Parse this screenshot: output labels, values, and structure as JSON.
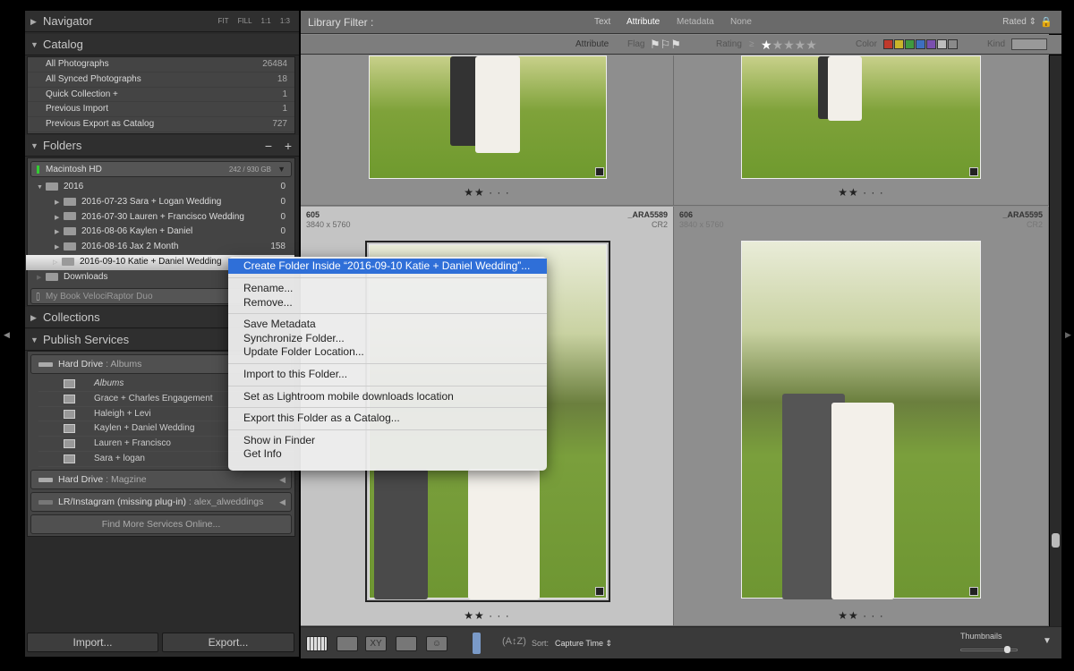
{
  "navigator": {
    "title": "Navigator",
    "zoom_options": [
      "FIT",
      "FILL",
      "1:1",
      "1:3"
    ]
  },
  "catalog": {
    "title": "Catalog",
    "items": [
      {
        "label": "All Photographs",
        "count": "26484"
      },
      {
        "label": "All Synced Photographs",
        "count": "18"
      },
      {
        "label": "Quick Collection +",
        "count": "1"
      },
      {
        "label": "Previous Import",
        "count": "1"
      },
      {
        "label": "Previous Export as Catalog",
        "count": "727"
      }
    ]
  },
  "folders": {
    "title": "Folders",
    "minus": "−",
    "plus": "+",
    "volume": {
      "name": "Macintosh HD",
      "space": "242 / 930 GB"
    },
    "year": {
      "label": "2016",
      "count": "0"
    },
    "items": [
      {
        "label": "2016-07-23 Sara + Logan Wedding",
        "count": "0"
      },
      {
        "label": "2016-07-30 Lauren + Francisco Wedding",
        "count": "0"
      },
      {
        "label": "2016-08-06 Kaylen + Daniel",
        "count": "0"
      },
      {
        "label": "2016-08-16 Jax 2 Month",
        "count": "158"
      },
      {
        "label": "2016-09-10 Katie + Daniel Wedding",
        "count": ""
      }
    ],
    "downloads": "Downloads",
    "volume2": "My Book VelociRaptor Duo"
  },
  "collections": {
    "title": "Collections"
  },
  "publish": {
    "title": "Publish Services",
    "service1": {
      "name": "Hard Drive",
      "sub": "Albums"
    },
    "collections": [
      "Albums",
      "Grace + Charles Engagement",
      "Haleigh + Levi",
      "Kaylen + Daniel Wedding",
      "Lauren + Francisco",
      "Sara + logan"
    ],
    "service2": {
      "name": "Hard Drive",
      "sub": "Magzine"
    },
    "service3": {
      "name": "LR/Instagram (missing plug-in)",
      "sub": "alex_alweddings"
    },
    "find_more": "Find More Services Online..."
  },
  "import_label": "Import...",
  "export_label": "Export...",
  "filter": {
    "title": "Library Filter :",
    "tabs": [
      "Text",
      "Attribute",
      "Metadata",
      "None"
    ],
    "active": "Attribute",
    "preset": "Rated",
    "attribute_label": "Attribute",
    "flag_label": "Flag",
    "rating_label": "Rating",
    "rating_op": "≥",
    "color_label": "Color",
    "kind_label": "Kind",
    "colors": [
      "#c0392b",
      "#c9b52a",
      "#3f9a3f",
      "#3d6fbf",
      "#7a4fae",
      "#bdbdbd",
      "#8a8a8a"
    ]
  },
  "grid": {
    "cells": [
      {
        "stars": "★★ · · ·"
      },
      {
        "stars": "★★ · · ·"
      },
      {
        "index": "605",
        "dims": "3840 x 5760",
        "filename": "_ARA5589",
        "ext": "CR2",
        "stars": "★★ · · ·",
        "selected": true
      },
      {
        "index": "606",
        "dims": "3840 x 5760",
        "filename": "_ARA5595",
        "ext": "CR2",
        "stars": "★★ · · ·"
      }
    ]
  },
  "context_menu": {
    "groups": [
      [
        "Create Folder Inside “2016-09-10 Katie + Daniel Wedding”..."
      ],
      [
        "Rename...",
        "Remove..."
      ],
      [
        "Save Metadata",
        "Synchronize Folder...",
        "Update Folder Location..."
      ],
      [
        "Import to this Folder..."
      ],
      [
        "Set as Lightroom mobile downloads location"
      ],
      [
        "Export this Folder as a Catalog..."
      ],
      [
        "Show in Finder",
        "Get Info"
      ]
    ],
    "highlighted": "Create Folder Inside “2016-09-10 Katie + Daniel Wedding”..."
  },
  "toolbar": {
    "sort_label": "Sort:",
    "sort_value": "Capture Time",
    "thumbnails_label": "Thumbnails",
    "thumbnail_size": 0.85,
    "compare_label": "XY"
  }
}
